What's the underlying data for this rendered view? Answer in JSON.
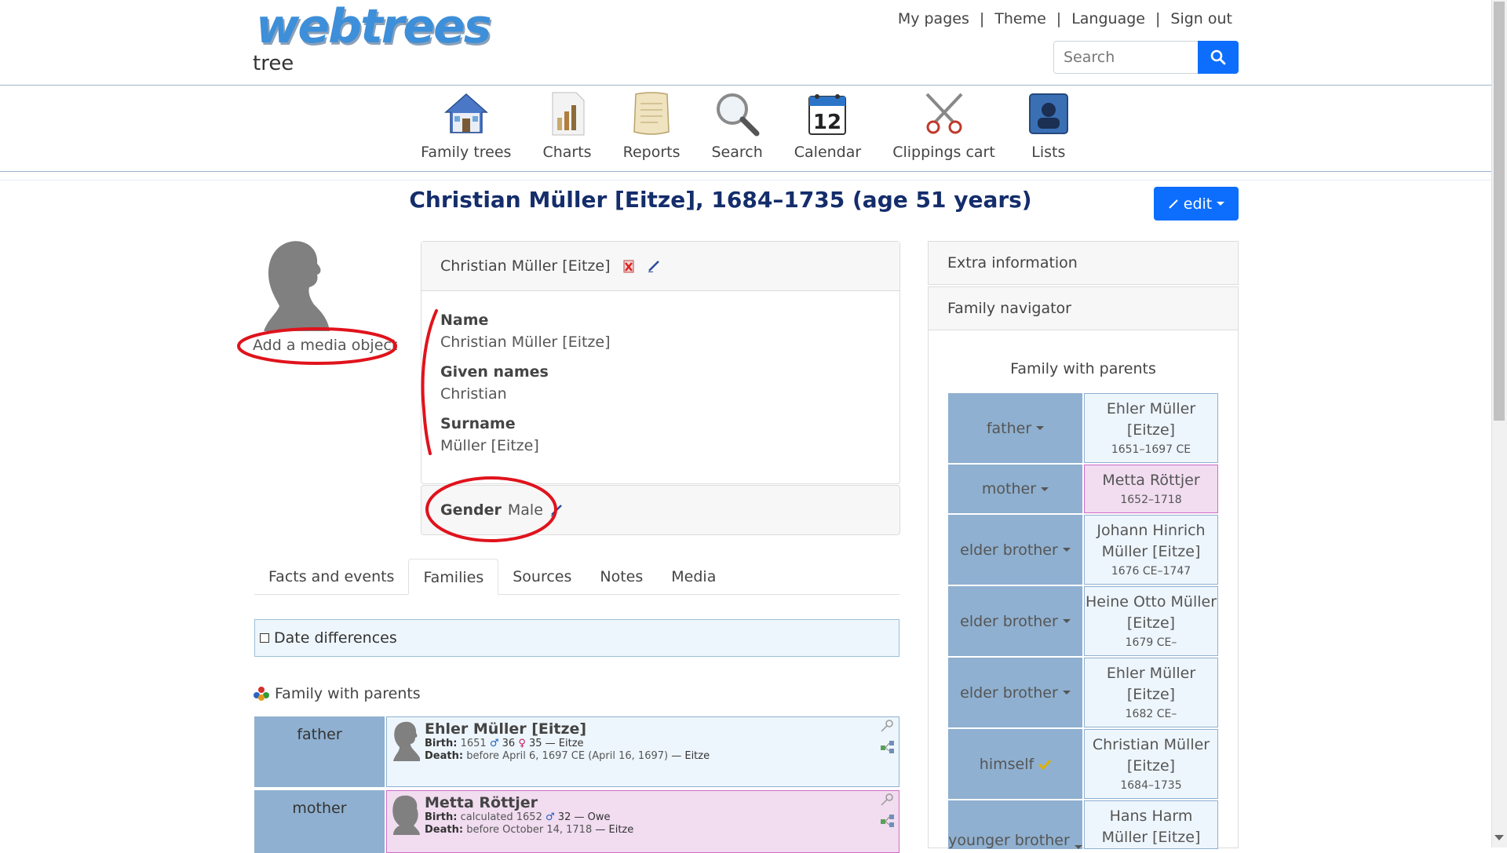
{
  "header": {
    "logo_text": "webtrees",
    "tree_title": "tree",
    "menu": [
      "My pages",
      "Theme",
      "Language",
      "Sign out"
    ],
    "search_placeholder": "Search"
  },
  "primary_menu": [
    {
      "label": "Family trees",
      "icon": "house-icon"
    },
    {
      "label": "Charts",
      "icon": "chart-icon"
    },
    {
      "label": "Reports",
      "icon": "scroll-icon"
    },
    {
      "label": "Search",
      "icon": "magnifier-icon"
    },
    {
      "label": "Calendar",
      "icon": "calendar-icon",
      "day": "12"
    },
    {
      "label": "Clippings cart",
      "icon": "scissors-icon"
    },
    {
      "label": "Lists",
      "icon": "lists-icon"
    }
  ],
  "page": {
    "title": "Christian Müller [Eitze], 1684–1735 (age 51 years)",
    "edit_label": "edit",
    "add_media_label": "Add a media object"
  },
  "name_card": {
    "header": "Christian Müller [Eitze]",
    "fields": [
      {
        "label": "Name",
        "value": "Christian Müller [Eitze]"
      },
      {
        "label": "Given names",
        "value": "Christian"
      },
      {
        "label": "Surname",
        "value": "Müller [Eitze]"
      }
    ],
    "gender_label": "Gender",
    "gender_value": "Male"
  },
  "tabs": [
    "Facts and events",
    "Families",
    "Sources",
    "Notes",
    "Media"
  ],
  "active_tab": "Families",
  "families": {
    "date_differences_label": "Date differences",
    "heading": "Family with parents",
    "rows": [
      {
        "role": "father",
        "sex": "male",
        "name": "Ehler Müller [Eitze]",
        "birth_label": "Birth:",
        "birth_date": "1651",
        "birth_father_age": "36",
        "birth_mother_age": "35",
        "birth_place": "— Eitze",
        "death_label": "Death:",
        "death_date": "before April 6, 1697 CE (April 16, 1697)",
        "death_place": "— Eitze"
      },
      {
        "role": "mother",
        "sex": "female",
        "name": "Metta Röttjer",
        "birth_label": "Birth:",
        "birth_date": "calculated 1652",
        "birth_father_age": "32",
        "birth_place": "— Owe",
        "death_label": "Death:",
        "death_date": "before October 14, 1718",
        "death_place": "— Eitze"
      }
    ]
  },
  "sidebar": {
    "extra_info_label": "Extra information",
    "family_navigator_label": "Family navigator",
    "nav_title": "Family with parents",
    "rows": [
      {
        "role": "father",
        "name": "Ehler Müller [Eitze]",
        "dates": "1651–1697 CE",
        "sex": "male"
      },
      {
        "role": "mother",
        "name": "Metta Röttjer",
        "dates": "1652–1718",
        "sex": "female"
      },
      {
        "role": "elder brother",
        "name": "Johann Hinrich Müller [Eitze]",
        "dates": "1676 CE–1747",
        "sex": "male"
      },
      {
        "role": "elder brother",
        "name": "Heine Otto Müller [Eitze]",
        "dates": "1679 CE–",
        "sex": "male"
      },
      {
        "role": "elder brother",
        "name": "Ehler Müller [Eitze]",
        "dates": "1682 CE–",
        "sex": "male"
      },
      {
        "role": "himself",
        "name": "Christian Müller [Eitze]",
        "dates": "1684–1735",
        "sex": "male"
      },
      {
        "role": "younger brother",
        "name": "Hans Harm Müller [Eitze]",
        "dates": "",
        "sex": "male"
      }
    ]
  },
  "colors": {
    "accent": "#0d6efd",
    "title": "#142d6b",
    "role_cell": "#8fb0d0",
    "male_bg": "#eef6fd",
    "female_bg": "#f1dcf0",
    "annotation": "#e0131c"
  }
}
